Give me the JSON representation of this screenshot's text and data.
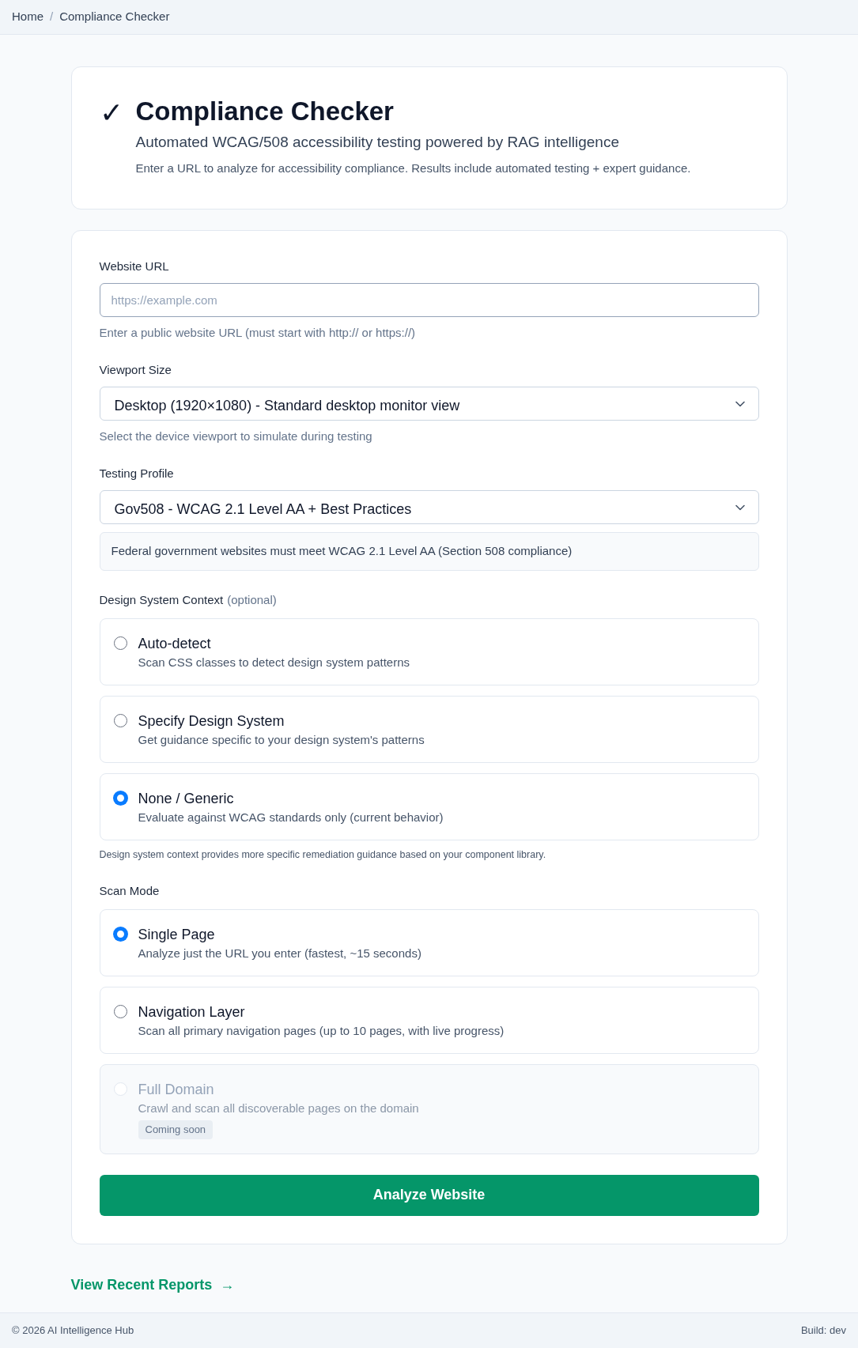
{
  "breadcrumb": [
    {
      "label": "Home"
    },
    {
      "label": "Compliance Checker"
    }
  ],
  "breadcrumb_separator": "/",
  "header": {
    "icon": "✓",
    "title": "Compliance Checker",
    "subtitle": "Automated WCAG/508 accessibility testing powered by RAG intelligence",
    "description": "Enter a URL to analyze for accessibility compliance. Results include automated testing + expert guidance."
  },
  "url_field": {
    "label": "Website URL",
    "placeholder": "https://example.com",
    "help": "Enter a public website URL (must start with http:// or https://)"
  },
  "viewport": {
    "label": "Viewport Size",
    "value": "Desktop (1920×1080) - Standard desktop monitor view",
    "help": "Select the device viewport to simulate during testing"
  },
  "testing_profile": {
    "label": "Testing Profile",
    "value": "Gov508 - WCAG 2.1 Level AA + Best Practices",
    "info": "Federal government websites must meet WCAG 2.1 Level AA (Section 508 compliance)"
  },
  "design_system": {
    "label": "Design System Context",
    "optional": "(optional)",
    "options": [
      {
        "title": "Auto-detect",
        "description": "Scan CSS classes to detect design system patterns",
        "selected": false
      },
      {
        "title": "Specify Design System",
        "description": "Get guidance specific to your design system's patterns",
        "selected": false
      },
      {
        "title": "None / Generic",
        "description": "Evaluate against WCAG standards only (current behavior)",
        "selected": true
      }
    ],
    "note": "Design system context provides more specific remediation guidance based on your component library."
  },
  "scan_mode": {
    "label": "Scan Mode",
    "options": [
      {
        "title": "Single Page",
        "description": "Analyze just the URL you enter (fastest, ~15 seconds)",
        "selected": true,
        "disabled": false
      },
      {
        "title": "Navigation Layer",
        "description": "Scan all primary navigation pages (up to 10 pages, with live progress)",
        "selected": false,
        "disabled": false
      },
      {
        "title": "Full Domain",
        "description": "Crawl and scan all discoverable pages on the domain",
        "selected": false,
        "disabled": true,
        "badge": "Coming soon"
      }
    ]
  },
  "submit_button": "Analyze Website",
  "recent_reports_link": {
    "label": "View Recent Reports",
    "arrow": "→"
  },
  "footer": {
    "copyright": "© 2026 AI Intelligence Hub",
    "build": "Build: dev"
  }
}
